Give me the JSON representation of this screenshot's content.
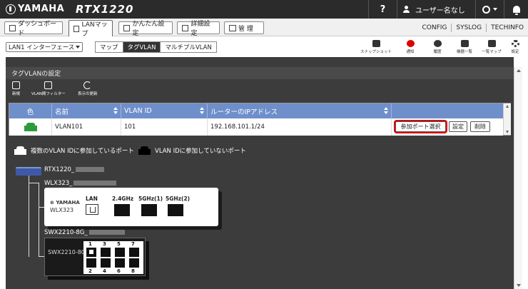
{
  "header": {
    "logo": "YAMAHA",
    "model": "RTX1220",
    "help": "?",
    "user": "ユーザー名なし"
  },
  "nav": {
    "tabs": [
      {
        "label": "ダッシュボード"
      },
      {
        "label": "LANマップ",
        "active": true
      },
      {
        "label": "かんたん設定"
      },
      {
        "label": "詳細設定"
      },
      {
        "label": "管 理"
      }
    ],
    "links": [
      "CONFIG",
      "SYSLOG",
      "TECHINFO"
    ]
  },
  "toolbar": {
    "interface_select": "LAN1 インターフェース",
    "view_modes": [
      "マップ",
      "タグVLAN",
      "マルチプルVLAN"
    ],
    "selected_mode": "タグVLAN",
    "tools": [
      {
        "label": "スナップショット",
        "icon": "camera-icon"
      },
      {
        "label": "通知",
        "icon": "alert-icon",
        "color": "#dd0000"
      },
      {
        "label": "履歴",
        "icon": "history-icon"
      },
      {
        "label": "機器一覧",
        "icon": "device-list-icon"
      },
      {
        "label": "一覧マップ",
        "icon": "list-map-icon"
      },
      {
        "label": "設定",
        "icon": "gear-icon"
      }
    ]
  },
  "panel": {
    "title": "タグVLANの設定",
    "actions": [
      {
        "label": "新規",
        "icon": "edit-icon"
      },
      {
        "label": "VLAN間フィルター",
        "icon": "filter-icon"
      },
      {
        "label": "表示の更新",
        "icon": "refresh-icon"
      }
    ]
  },
  "table": {
    "headers": [
      "色",
      "名前",
      "VLAN ID",
      "ルーターのIPアドレス"
    ],
    "rows": [
      {
        "color": "#2c9b3b",
        "name": "VLAN101",
        "vlan_id": "101",
        "ip": "192.168.101.1/24",
        "buttons": [
          "参加ポート選択",
          "設定",
          "削除"
        ]
      }
    ],
    "highlight_color": "#e00000"
  },
  "legend": {
    "multi": "複数のVLAN IDに参加しているポート",
    "none": "VLAN IDに参加していないポート"
  },
  "topology": {
    "router": "RTX1220_",
    "wlx_name": "WLX323_",
    "wlx_brand": "YAMAHA",
    "wlx_model": "WLX323",
    "wlx_ports": [
      "LAN",
      "2.4GHz",
      "5GHz(1)",
      "5GHz(2)"
    ],
    "swx_name": "SWX2210-8G_",
    "swx_model": "SWX2210-8G",
    "swx_ports_top": [
      "1",
      "3",
      "5",
      "7"
    ],
    "swx_ports_bottom": [
      "2",
      "4",
      "6",
      "8"
    ]
  }
}
